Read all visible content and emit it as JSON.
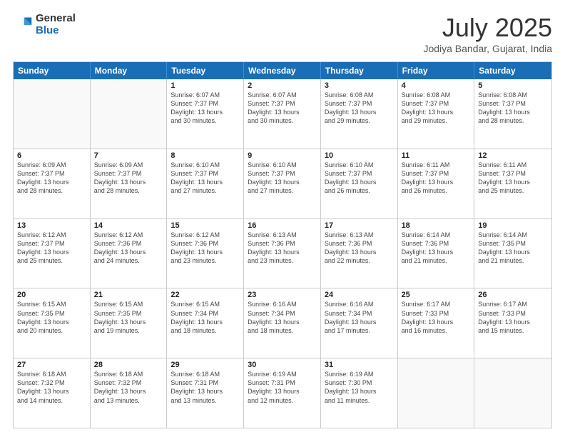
{
  "logo": {
    "general": "General",
    "blue": "Blue"
  },
  "title": "July 2025",
  "location": "Jodiya Bandar, Gujarat, India",
  "header_days": [
    "Sunday",
    "Monday",
    "Tuesday",
    "Wednesday",
    "Thursday",
    "Friday",
    "Saturday"
  ],
  "weeks": [
    [
      {
        "day": "",
        "info": ""
      },
      {
        "day": "",
        "info": ""
      },
      {
        "day": "1",
        "info": "Sunrise: 6:07 AM\nSunset: 7:37 PM\nDaylight: 13 hours\nand 30 minutes."
      },
      {
        "day": "2",
        "info": "Sunrise: 6:07 AM\nSunset: 7:37 PM\nDaylight: 13 hours\nand 30 minutes."
      },
      {
        "day": "3",
        "info": "Sunrise: 6:08 AM\nSunset: 7:37 PM\nDaylight: 13 hours\nand 29 minutes."
      },
      {
        "day": "4",
        "info": "Sunrise: 6:08 AM\nSunset: 7:37 PM\nDaylight: 13 hours\nand 29 minutes."
      },
      {
        "day": "5",
        "info": "Sunrise: 6:08 AM\nSunset: 7:37 PM\nDaylight: 13 hours\nand 28 minutes."
      }
    ],
    [
      {
        "day": "6",
        "info": "Sunrise: 6:09 AM\nSunset: 7:37 PM\nDaylight: 13 hours\nand 28 minutes."
      },
      {
        "day": "7",
        "info": "Sunrise: 6:09 AM\nSunset: 7:37 PM\nDaylight: 13 hours\nand 28 minutes."
      },
      {
        "day": "8",
        "info": "Sunrise: 6:10 AM\nSunset: 7:37 PM\nDaylight: 13 hours\nand 27 minutes."
      },
      {
        "day": "9",
        "info": "Sunrise: 6:10 AM\nSunset: 7:37 PM\nDaylight: 13 hours\nand 27 minutes."
      },
      {
        "day": "10",
        "info": "Sunrise: 6:10 AM\nSunset: 7:37 PM\nDaylight: 13 hours\nand 26 minutes."
      },
      {
        "day": "11",
        "info": "Sunrise: 6:11 AM\nSunset: 7:37 PM\nDaylight: 13 hours\nand 26 minutes."
      },
      {
        "day": "12",
        "info": "Sunrise: 6:11 AM\nSunset: 7:37 PM\nDaylight: 13 hours\nand 25 minutes."
      }
    ],
    [
      {
        "day": "13",
        "info": "Sunrise: 6:12 AM\nSunset: 7:37 PM\nDaylight: 13 hours\nand 25 minutes."
      },
      {
        "day": "14",
        "info": "Sunrise: 6:12 AM\nSunset: 7:36 PM\nDaylight: 13 hours\nand 24 minutes."
      },
      {
        "day": "15",
        "info": "Sunrise: 6:12 AM\nSunset: 7:36 PM\nDaylight: 13 hours\nand 23 minutes."
      },
      {
        "day": "16",
        "info": "Sunrise: 6:13 AM\nSunset: 7:36 PM\nDaylight: 13 hours\nand 23 minutes."
      },
      {
        "day": "17",
        "info": "Sunrise: 6:13 AM\nSunset: 7:36 PM\nDaylight: 13 hours\nand 22 minutes."
      },
      {
        "day": "18",
        "info": "Sunrise: 6:14 AM\nSunset: 7:36 PM\nDaylight: 13 hours\nand 21 minutes."
      },
      {
        "day": "19",
        "info": "Sunrise: 6:14 AM\nSunset: 7:35 PM\nDaylight: 13 hours\nand 21 minutes."
      }
    ],
    [
      {
        "day": "20",
        "info": "Sunrise: 6:15 AM\nSunset: 7:35 PM\nDaylight: 13 hours\nand 20 minutes."
      },
      {
        "day": "21",
        "info": "Sunrise: 6:15 AM\nSunset: 7:35 PM\nDaylight: 13 hours\nand 19 minutes."
      },
      {
        "day": "22",
        "info": "Sunrise: 6:15 AM\nSunset: 7:34 PM\nDaylight: 13 hours\nand 18 minutes."
      },
      {
        "day": "23",
        "info": "Sunrise: 6:16 AM\nSunset: 7:34 PM\nDaylight: 13 hours\nand 18 minutes."
      },
      {
        "day": "24",
        "info": "Sunrise: 6:16 AM\nSunset: 7:34 PM\nDaylight: 13 hours\nand 17 minutes."
      },
      {
        "day": "25",
        "info": "Sunrise: 6:17 AM\nSunset: 7:33 PM\nDaylight: 13 hours\nand 16 minutes."
      },
      {
        "day": "26",
        "info": "Sunrise: 6:17 AM\nSunset: 7:33 PM\nDaylight: 13 hours\nand 15 minutes."
      }
    ],
    [
      {
        "day": "27",
        "info": "Sunrise: 6:18 AM\nSunset: 7:32 PM\nDaylight: 13 hours\nand 14 minutes."
      },
      {
        "day": "28",
        "info": "Sunrise: 6:18 AM\nSunset: 7:32 PM\nDaylight: 13 hours\nand 13 minutes."
      },
      {
        "day": "29",
        "info": "Sunrise: 6:18 AM\nSunset: 7:31 PM\nDaylight: 13 hours\nand 13 minutes."
      },
      {
        "day": "30",
        "info": "Sunrise: 6:19 AM\nSunset: 7:31 PM\nDaylight: 13 hours\nand 12 minutes."
      },
      {
        "day": "31",
        "info": "Sunrise: 6:19 AM\nSunset: 7:30 PM\nDaylight: 13 hours\nand 11 minutes."
      },
      {
        "day": "",
        "info": ""
      },
      {
        "day": "",
        "info": ""
      }
    ]
  ]
}
